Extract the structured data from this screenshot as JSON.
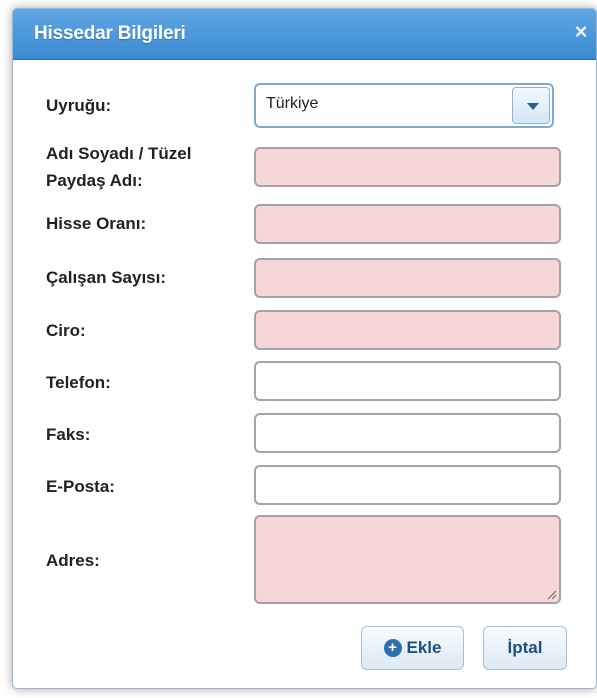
{
  "dialog": {
    "title": "Hissedar Bilgileri",
    "close_icon": "×"
  },
  "form": {
    "nationality_label": "Uyruğu:",
    "nationality_value": "Türkiye",
    "name_label_line1": "Adı Soyadı / Tüzel",
    "name_label_line2": "Paydaş Adı:",
    "share_label": "Hisse Oranı:",
    "employees_label": "Çalışan Sayısı:",
    "turnover_label": "Ciro:",
    "phone_label": "Telefon:",
    "fax_label": "Faks:",
    "email_label": "E-Posta:",
    "address_label": "Adres:"
  },
  "buttons": {
    "add_label": "Ekle",
    "add_icon": "+",
    "cancel_label": "İptal"
  },
  "colors": {
    "title_bar": "#3c8ad2",
    "required_field_bg": "#f6d6d6",
    "optional_field_bg": "#ffffff",
    "button_text": "#1f4f7f"
  }
}
